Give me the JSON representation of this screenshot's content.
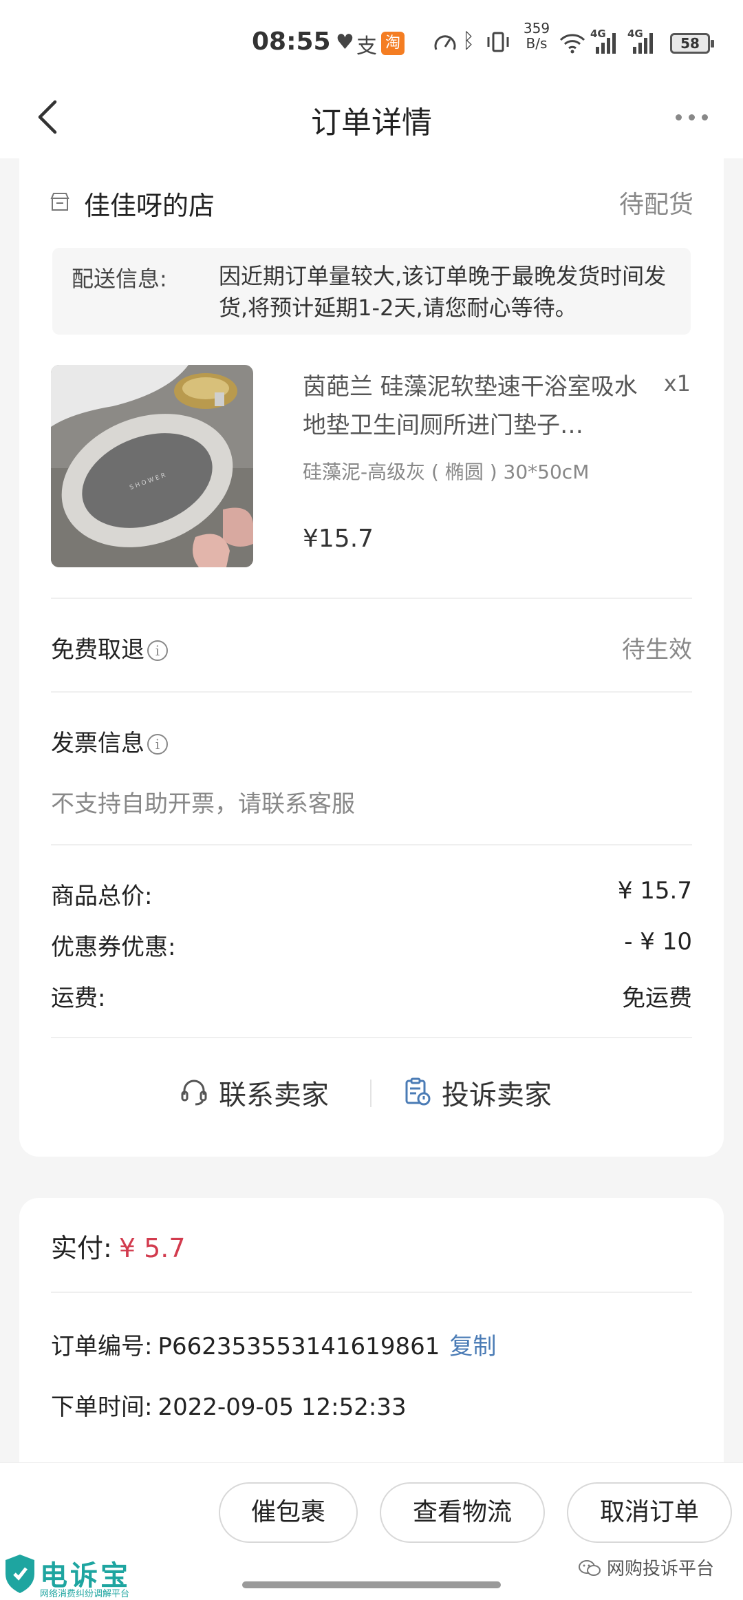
{
  "status_bar": {
    "time": "08:55",
    "taobao_badge": "淘",
    "alipay_glyph": "支",
    "net_speed_value": "359",
    "net_speed_unit": "B/s",
    "signal_1": "4G",
    "signal_2": "4G",
    "battery": "58"
  },
  "header": {
    "title": "订单详情"
  },
  "shop": {
    "name": "佳佳呀的店",
    "status": "待配货"
  },
  "delivery": {
    "label": "配送信息:",
    "message": "因近期订单量较大,该订单晚于最晚发货时间发货,将预计延期1-2天,请您耐心等待。"
  },
  "product": {
    "name": "茵葩兰 硅藻泥软垫速干浴室吸水地垫卫生间厕所进门垫子…",
    "quantity": "x1",
    "spec": "硅藻泥-高级灰 ( 椭圆 ) 30*50cM",
    "price": "¥15.7",
    "image": "bath-mat-photo"
  },
  "free_cancel": {
    "label": "免费取退",
    "status": "待生效"
  },
  "invoice": {
    "label": "发票信息",
    "note": "不支持自助开票，请联系客服"
  },
  "summary": [
    {
      "label": "商品总价:",
      "value": "¥ 15.7"
    },
    {
      "label": "优惠券优惠:",
      "value": "- ¥ 10"
    },
    {
      "label": "运费:",
      "value": "免运费"
    }
  ],
  "actions": {
    "contact": "联系卖家",
    "complain": "投诉卖家"
  },
  "payment": {
    "label": "实付:",
    "amount": "¥ 5.7"
  },
  "order": {
    "number_label": "订单编号:",
    "number": "P662353553141619861",
    "copy": "复制",
    "time_label": "下单时间:",
    "time": "2022-09-05 12:52:33"
  },
  "bottom_buttons": {
    "urge": "催包裹",
    "logistics": "查看物流",
    "cancel": "取消订单"
  },
  "watermarks": {
    "left_brand": "电诉宝",
    "left_sub": "网络消费纠纷调解平台",
    "right": "网购投诉平台"
  },
  "colors": {
    "price_red": "#d23b4e",
    "link_blue": "#4a7bb5",
    "muted": "#888888"
  }
}
